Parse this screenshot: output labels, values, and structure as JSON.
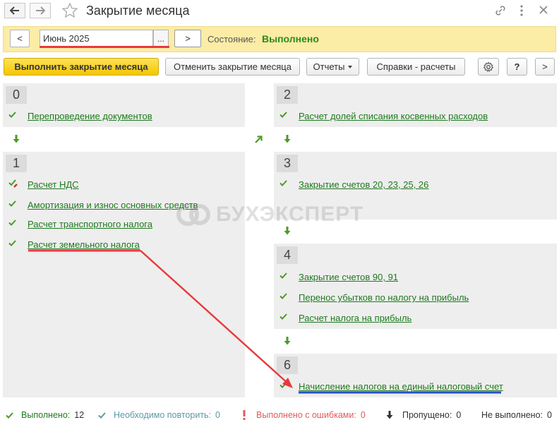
{
  "window": {
    "title": "Закрытие месяца",
    "nav": {
      "back_icon": "arrow-left-icon",
      "forward_icon": "arrow-right-icon"
    },
    "icons": [
      "star-icon",
      "link-icon",
      "more-icon",
      "close-icon"
    ]
  },
  "period_bar": {
    "prev_label": "<",
    "period_value": "Июнь 2025",
    "choose_label": "...",
    "next_label": ">",
    "status_label": "Состояние:",
    "status_value": "Выполнено",
    "status_color": "#2e8a1e"
  },
  "toolbar": {
    "run_label": "Выполнить закрытие месяца",
    "cancel_label": "Отменить закрытие месяца",
    "reports_label": "Отчеты",
    "references_label": "Справки - расчеты",
    "settings_icon": "gear-icon",
    "help_label": "?",
    "more_label": ">"
  },
  "steps": [
    {
      "number": "0",
      "tasks": [
        {
          "label": "Перепроведение документов",
          "state": "done"
        }
      ]
    },
    {
      "number": "1",
      "tasks": [
        {
          "label": "Расчет НДС",
          "state": "done-edited"
        },
        {
          "label": "Амортизация и износ основных средств",
          "state": "done"
        },
        {
          "label": "Расчет транспортного налога",
          "state": "done"
        },
        {
          "label": "Расчет земельного налога",
          "state": "done"
        }
      ]
    },
    {
      "number": "2",
      "tasks": [
        {
          "label": "Расчет долей списания косвенных расходов",
          "state": "done"
        }
      ]
    },
    {
      "number": "3",
      "tasks": [
        {
          "label": "Закрытие счетов 20, 23, 25, 26",
          "state": "done"
        }
      ]
    },
    {
      "number": "4",
      "tasks": [
        {
          "label": "Закрытие счетов 90, 91",
          "state": "done"
        },
        {
          "label": "Перенос убытков по налогу на прибыль",
          "state": "done"
        },
        {
          "label": "Расчет налога на прибыль",
          "state": "done"
        }
      ]
    },
    {
      "number": "6",
      "tasks": [
        {
          "label": "Начисление налогов на единый налоговый счет",
          "state": "done"
        }
      ]
    }
  ],
  "watermark": {
    "text": "БУХЭКСПЕРТ"
  },
  "footer": {
    "done_label": "Выполнено:",
    "done_count": "12",
    "repeat_label": "Необходимо повторить:",
    "repeat_count": "0",
    "errors_label": "Выполнено с ошибками:",
    "errors_count": "0",
    "skipped_label": "Пропущено:",
    "skipped_count": "0",
    "not_done_label": "Не выполнено:",
    "not_done_count": "0"
  },
  "colors": {
    "link_green": "#1d7a1d",
    "check_green": "#4e9a28",
    "repeat_teal": "#5a9aa8",
    "error_red": "#e05a5a",
    "annotation_red": "#e8393c",
    "annotation_blue": "#2450c8"
  }
}
